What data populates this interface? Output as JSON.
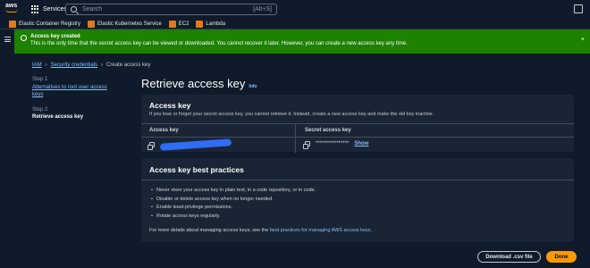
{
  "topbar": {
    "logo_text": "aws",
    "services_label": "Services",
    "search_placeholder": "Search",
    "search_shortcut": "[Alt+S]"
  },
  "favorites": [
    {
      "label": "Elastic Container Registry"
    },
    {
      "label": "Elastic Kubernetes Service"
    },
    {
      "label": "EC2"
    },
    {
      "label": "Lambda"
    }
  ],
  "flash": {
    "title": "Access key created",
    "message": "This is the only time that the secret access key can be viewed or downloaded. You cannot recover it later. However, you can create a new access key any time.",
    "close_icon": "×"
  },
  "breadcrumb": {
    "items": [
      "IAM",
      "Security credentials",
      "Create access key"
    ]
  },
  "steps": [
    {
      "num": "Step 1",
      "label": "Alternatives to root user access keys"
    },
    {
      "num": "Step 2",
      "label": "Retrieve access key"
    }
  ],
  "page": {
    "title": "Retrieve access key",
    "info": "Info"
  },
  "access_key": {
    "heading": "Access key",
    "description": "If you lose or forget your secret access key, you cannot retrieve it. Instead, create a new access key and make the old key inactive.",
    "col_access": "Access key",
    "col_secret": "Secret access key",
    "secret_masked": "****************",
    "show_label": "Show"
  },
  "best_practices": {
    "heading": "Access key best practices",
    "items": [
      "Never store your access key in plain text, in a code repository, or in code.",
      "Disable or delete access key when no longer needed.",
      "Enable least-privilege permissions.",
      "Rotate access keys regularly."
    ],
    "more_prefix": "For more details about managing access keys, see the ",
    "more_link": "best practices for managing AWS access keys",
    "more_suffix": "."
  },
  "buttons": {
    "download": "Download .csv file",
    "done": "Done"
  },
  "colors": {
    "flash_green": "#1d8102",
    "link_blue": "#89bdff",
    "primary_orange": "#ff9900",
    "redaction_blue": "#2f6df6"
  }
}
